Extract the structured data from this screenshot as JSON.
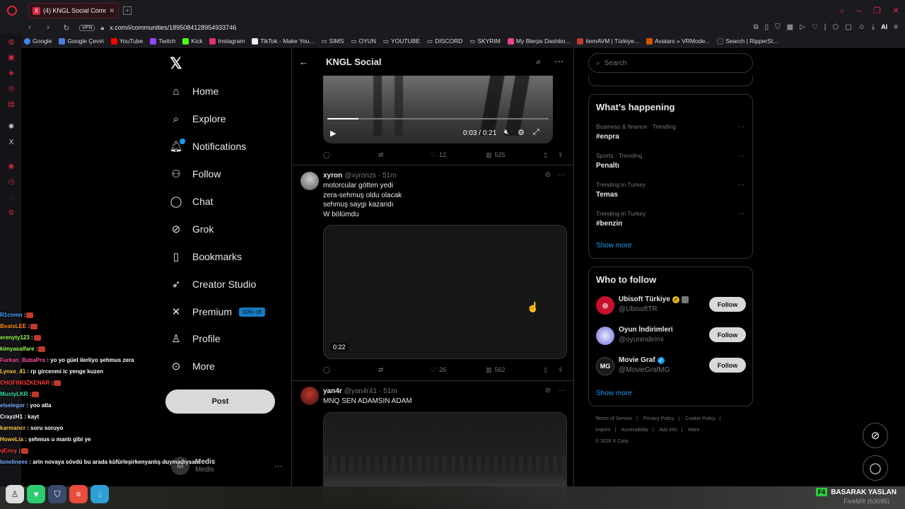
{
  "browser": {
    "tab_title": "(4) KNGL Social Commun",
    "url": "x.com/i/communities/1895084128954933746",
    "vpn_label": "VPN",
    "ai_label": "AI",
    "bookmarks": [
      "Google",
      "Google Çeviri",
      "YouTube",
      "Twitch",
      "Kick",
      "Instagram",
      "TikTok - Make You...",
      "SIMS",
      "OYUN",
      "YOUTUBE",
      "DISCORD",
      "SKYRIM",
      "My Blerps Dashbo...",
      "itemAVM | Türkiye...",
      "Avatars » VRMode...",
      "Search | RipperSt..."
    ]
  },
  "nav": {
    "home": "Home",
    "explore": "Explore",
    "notifications": "Notifications",
    "follow": "Follow",
    "chat": "Chat",
    "grok": "Grok",
    "bookmarks": "Bookmarks",
    "creator_studio": "Creator Studio",
    "premium": "Premium",
    "premium_badge": "50% off",
    "profile": "Profile",
    "more": "More",
    "post": "Post"
  },
  "account": {
    "name": "Medis",
    "handle": "Medis"
  },
  "header": {
    "title": "KNGL Social"
  },
  "tweets": [
    {
      "video_time": "0:03 / 0:21",
      "video_progress": 0.14,
      "replies": "",
      "reposts": "",
      "likes": "12",
      "views": "525"
    },
    {
      "name": "xyron",
      "handle": "@xyronzs",
      "time": "· 51m",
      "lines": [
        "motorcular götten yedi",
        "zera-sehmuş oldu olacak",
        "sehmuş saygı kazandı",
        "W bölümdu"
      ],
      "video_duration": "0:22",
      "likes": "26",
      "views": "562"
    },
    {
      "name": "yan4r",
      "handle": "@yan4r41",
      "time": "· 51m",
      "lines": [
        "MNQ SEN ADAMSIN ADAM"
      ]
    }
  ],
  "search": {
    "placeholder": "Search"
  },
  "happening": {
    "title": "What’s happening",
    "trends": [
      {
        "context": "Business & finance · Trending",
        "name": "#enpra"
      },
      {
        "context": "Sports · Trending",
        "name": "Penaltı"
      },
      {
        "context": "Trending in Turkey",
        "name": "Temas"
      },
      {
        "context": "Trending in Turkey",
        "name": "#benzin"
      }
    ],
    "show_more": "Show more"
  },
  "who_to_follow": {
    "title": "Who to follow",
    "accounts": [
      {
        "name": "Ubisoft Türkiye",
        "handle": "@UbisoftTR",
        "button": "Follow"
      },
      {
        "name": "Oyun İndirimleri",
        "handle": "@oyunindirimi",
        "button": "Follow"
      },
      {
        "name": "Movie Graf",
        "handle": "@MovieGrafMG",
        "avatar_text": "MG",
        "button": "Follow"
      }
    ],
    "show_more": "Show more"
  },
  "footer": {
    "links": [
      "Terms of Service",
      "Privacy Policy",
      "Cookie Policy",
      "Imprint",
      "Accessibility",
      "Ads info",
      "More ···"
    ],
    "copyright": "© 2026 X Corp."
  },
  "chat": [
    {
      "user": "R1comn",
      "color": "#4aa3ff",
      "msg": " :"
    },
    {
      "user": "BeatsLEE",
      "color": "#ff8c1a",
      "msg": " :"
    },
    {
      "user": "erenyty123",
      "color": "#9cff57",
      "msg": " :"
    },
    {
      "user": "kimyasalfare",
      "color": "#9cff57",
      "msg": " :"
    },
    {
      "user": "Furkan_BabaPro",
      "color": "#ff4fa3",
      "msg": " : yo yo güel ilerliyo şehmus zera"
    },
    {
      "user": "Lynxe_41",
      "color": "#ffd24a",
      "msg": " : rp gircenmi ic yenge kuzen"
    },
    {
      "user": "CHOFINOZKENAR",
      "color": "#ff3b3b",
      "msg": " :"
    },
    {
      "user": "MustyLKR",
      "color": "#33e0a1",
      "msg": " :"
    },
    {
      "user": "elselegor",
      "color": "#7fb2ff",
      "msg": " : yoo atla"
    },
    {
      "user": "CrayzH1",
      "color": "#ffffff",
      "msg": " : kayt"
    },
    {
      "user": "karmancr",
      "color": "#ffd24a",
      "msg": " : soru soruyo"
    },
    {
      "user": "HoweLia",
      "color": "#ffd24a",
      "msg": " : şehmus u mantı gibi ye"
    },
    {
      "user": "qEnvy",
      "color": "#ff3b3b",
      "msg": " :"
    },
    {
      "user": "lonelinees",
      "color": "#7fb2ff",
      "msg": " : arin novaya sövdü bu arada küfürleşirkenyanlış duymadıysam"
    }
  ],
  "hud": {
    "key": "F4",
    "label": "BASARAK YASLAN",
    "sub": "FiveM® (b3095)"
  },
  "colors": {
    "accent": "#1d9bf0",
    "opera": "#d4283e",
    "background": "#000000"
  }
}
